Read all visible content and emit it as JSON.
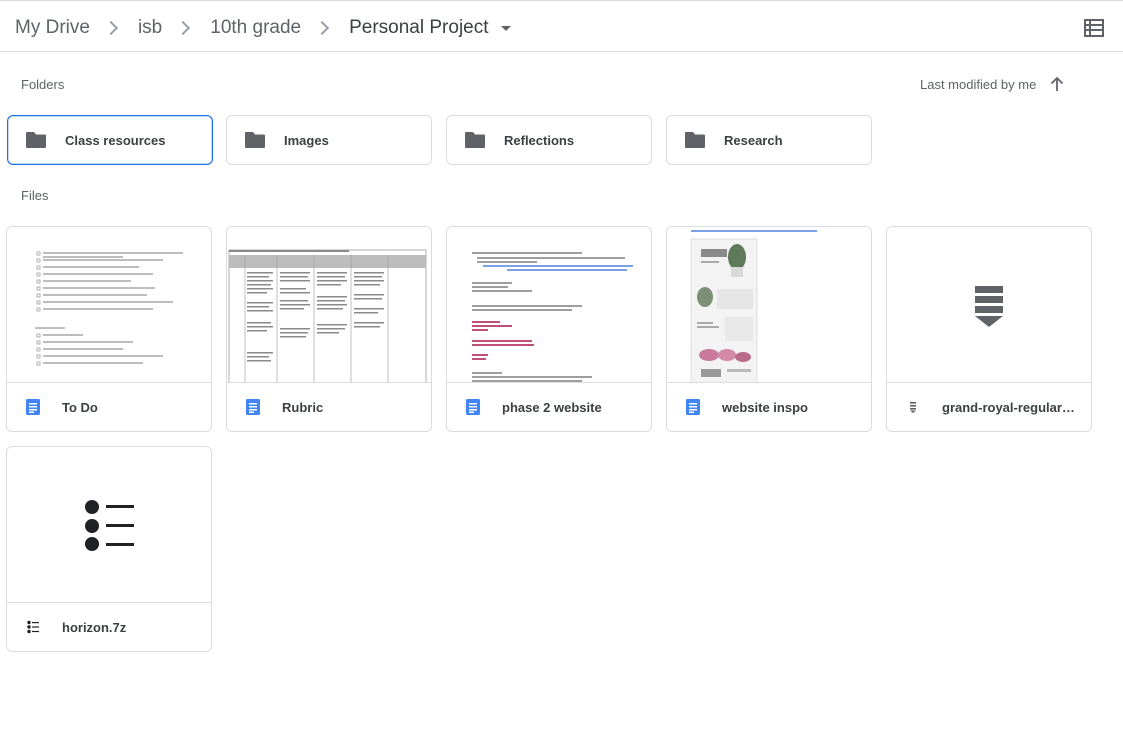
{
  "breadcrumb": {
    "items": [
      "My Drive",
      "isb",
      "10th grade"
    ],
    "current": "Personal Project"
  },
  "view_toggle_icon": "list-view-icon",
  "sections": {
    "folders_label": "Folders",
    "files_label": "Files"
  },
  "sort": {
    "label": "Last modified by me",
    "direction_icon": "arrow-up-icon"
  },
  "folders": [
    {
      "name": "Class resources",
      "selected": true
    },
    {
      "name": "Images",
      "selected": false
    },
    {
      "name": "Reflections",
      "selected": false
    },
    {
      "name": "Research",
      "selected": false
    }
  ],
  "files": [
    {
      "name": "To Do",
      "icon": "google-docs-icon"
    },
    {
      "name": "Rubric",
      "icon": "google-docs-icon"
    },
    {
      "name": "phase 2 website",
      "icon": "google-docs-icon"
    },
    {
      "name": "website inspo",
      "icon": "google-docs-icon"
    },
    {
      "name": "grand-royal-regular_x...",
      "icon": "font-file-icon"
    },
    {
      "name": "horizon.7z",
      "icon": "archive-list-icon"
    }
  ],
  "colors": {
    "docs_blue": "#4285f4",
    "selected_border": "#1a73e8",
    "icon_gray": "#5f6368"
  }
}
